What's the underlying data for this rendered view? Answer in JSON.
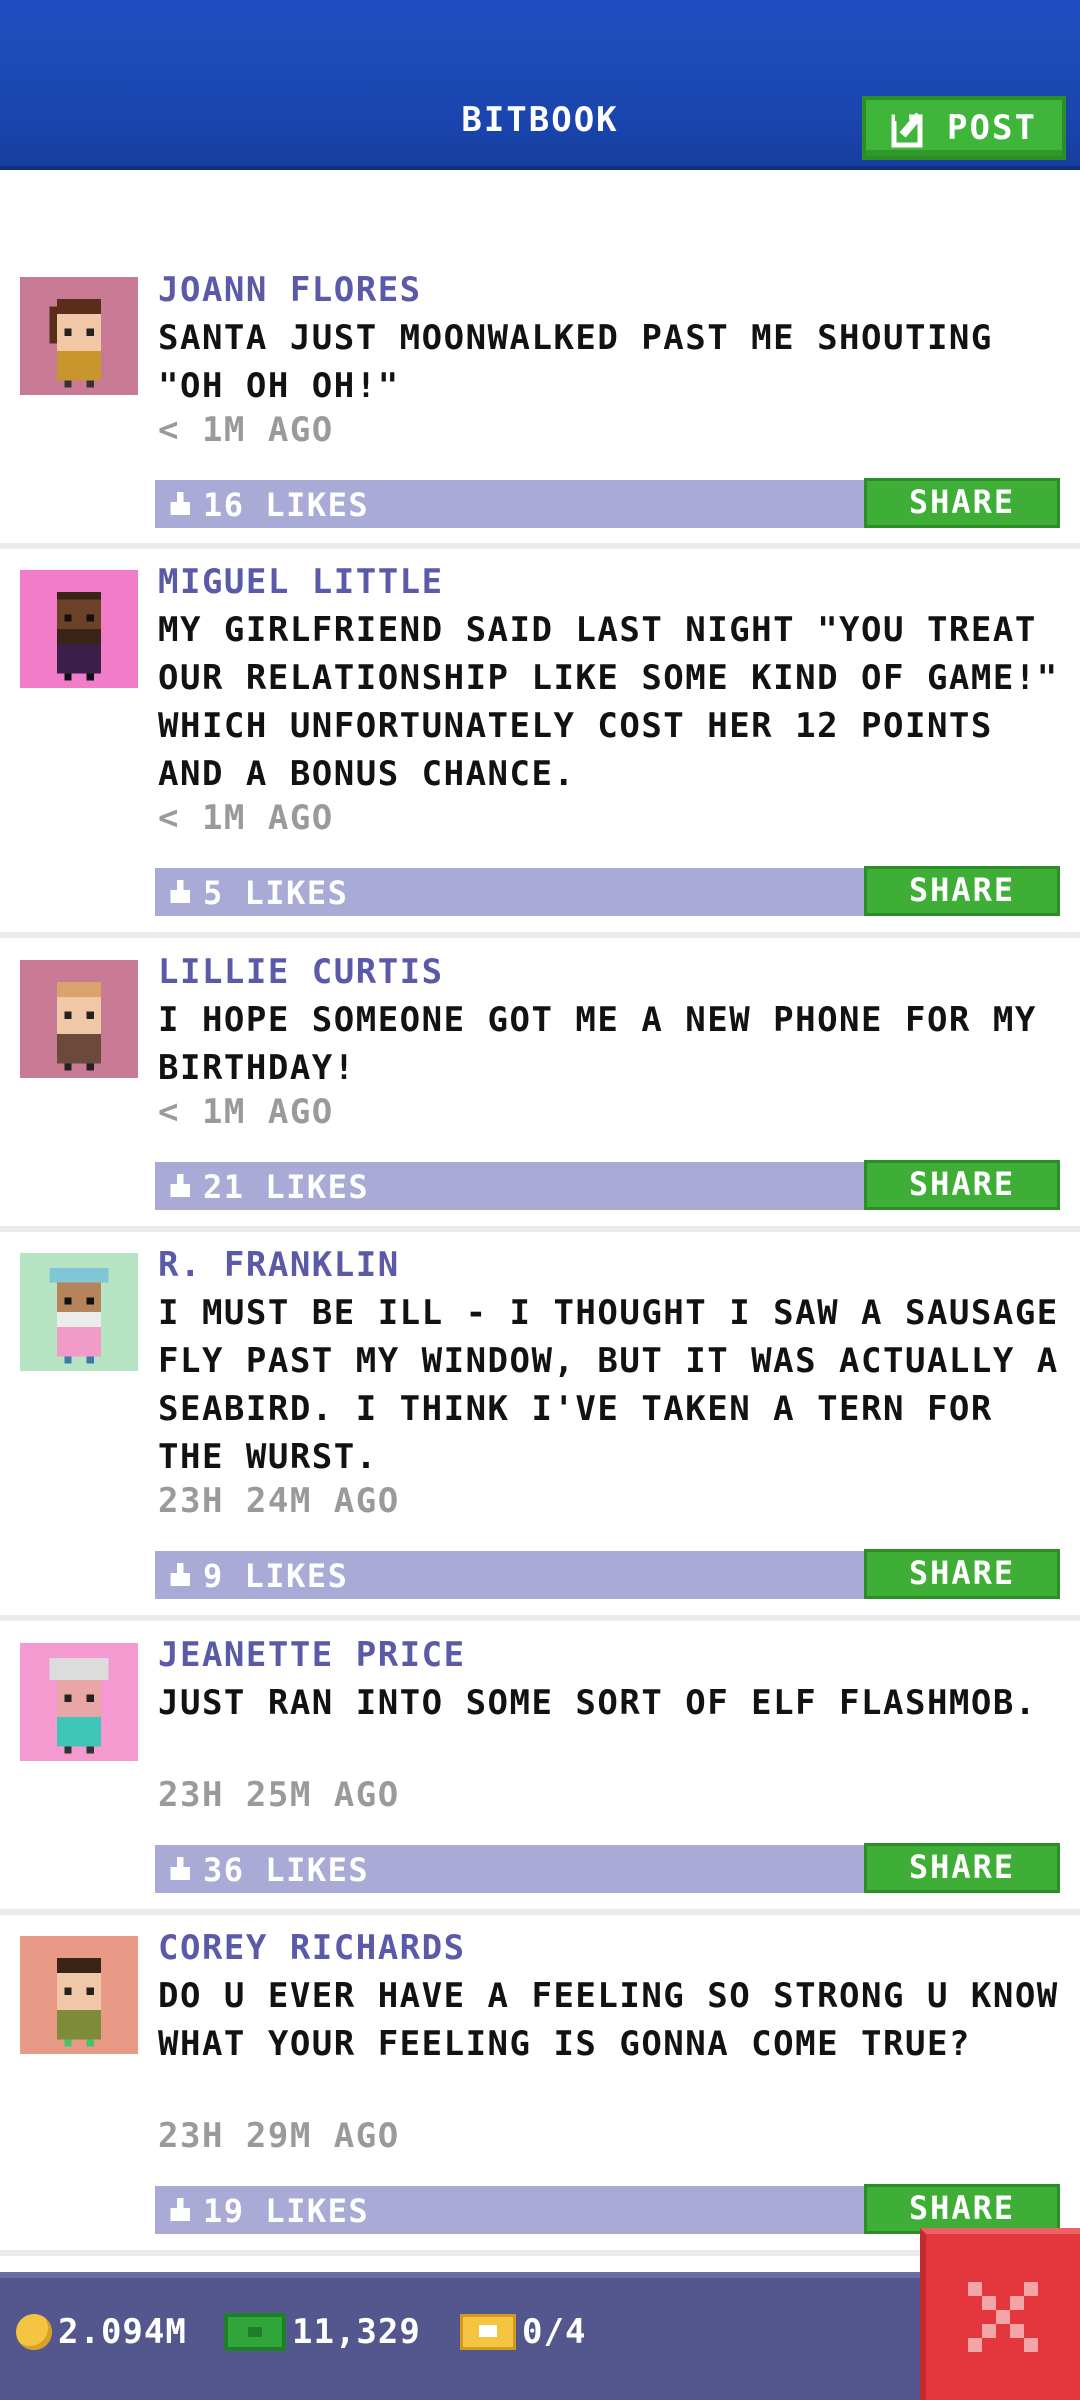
{
  "header": {
    "title": "BITBOOK",
    "post_label": "POST",
    "post_icon": "edit-icon"
  },
  "posts": [
    {
      "name": "JOANN FLORES",
      "message": "SANTA JUST MOONWALKED PAST ME SHOUTING \"OH OH OH!\"",
      "time": "< 1M AGO",
      "likes": "16 LIKES",
      "share_label": "SHARE",
      "avatar_bg": "#c97b95"
    },
    {
      "name": "MIGUEL LITTLE",
      "message": "MY GIRLFRIEND SAID LAST NIGHT \"YOU TREAT OUR RELATIONSHIP LIKE SOME KIND OF GAME!\" WHICH UNFORTUNATELY COST HER 12 POINTS AND A BONUS CHANCE.",
      "time": "< 1M AGO",
      "likes": "5 LIKES",
      "share_label": "SHARE",
      "avatar_bg": "#f17dc9"
    },
    {
      "name": "LILLIE CURTIS",
      "message": "I HOPE SOMEONE GOT ME A NEW PHONE FOR MY BIRTHDAY!",
      "time": "< 1M AGO",
      "likes": "21 LIKES",
      "share_label": "SHARE",
      "avatar_bg": "#c97b95"
    },
    {
      "name": "R. FRANKLIN",
      "message": "I MUST BE ILL - I THOUGHT I SAW A SAUSAGE FLY PAST MY WINDOW, BUT IT WAS ACTUALLY A SEABIRD. I THINK I'VE TAKEN A TERN FOR THE WURST.",
      "time": "23H 24M AGO",
      "likes": "9 LIKES",
      "share_label": "SHARE",
      "avatar_bg": "#b7e4c3"
    },
    {
      "name": "JEANETTE PRICE",
      "message": "JUST RAN INTO SOME SORT OF ELF FLASHMOB.",
      "time": "23H 25M AGO",
      "likes": "36 LIKES",
      "share_label": "SHARE",
      "avatar_bg": "#f59ad0"
    },
    {
      "name": "COREY RICHARDS",
      "message": "DO U EVER HAVE A FEELING SO STRONG U KNOW WHAT YOUR FEELING IS GONNA COME TRUE?",
      "time": "23H 29M AGO",
      "likes": "19 LIKES",
      "share_label": "SHARE",
      "avatar_bg": "#e89a86"
    }
  ],
  "status_bar": {
    "coins": "2.094M",
    "bux": "11,329",
    "tickets": "0/4"
  },
  "colors": {
    "header_blue": "#1a45ae",
    "accent_green": "#3fb53a",
    "like_bar": "#aaaad6",
    "name_purple": "#5a5aa8",
    "close_red": "#e4373d"
  }
}
